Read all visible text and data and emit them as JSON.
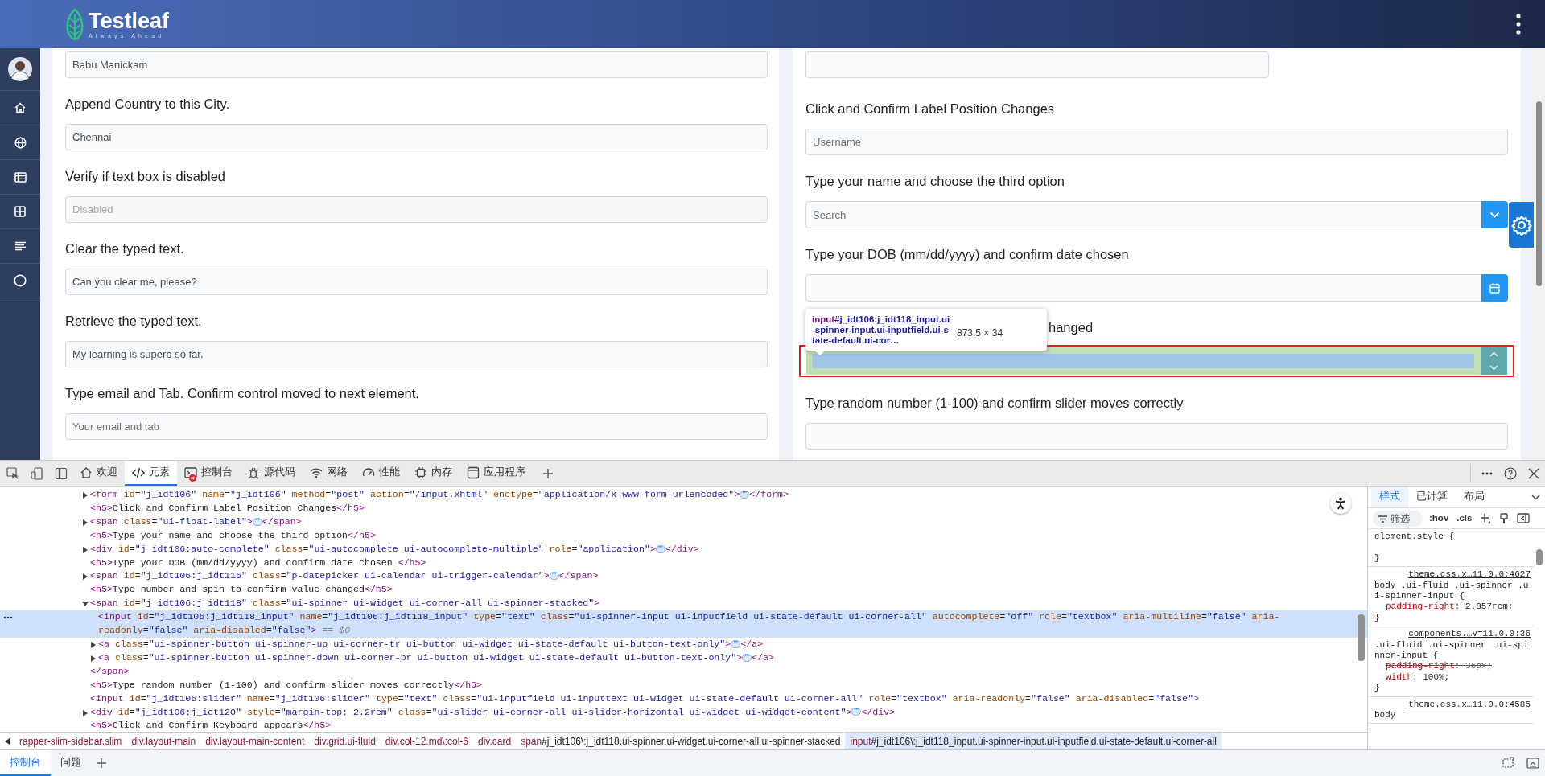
{
  "header": {
    "brand": "Testleaf",
    "tagline": "Always Ahead"
  },
  "left_form": {
    "sections": [
      {
        "value": "Babu Manickam",
        "disabled": false
      },
      {
        "label": "Append Country to this City.",
        "value": "Chennai",
        "disabled": false
      },
      {
        "label": "Verify if text box is disabled",
        "placeholder": "Disabled",
        "disabled": true
      },
      {
        "label": "Clear the typed text.",
        "value": "Can you clear me, please?",
        "disabled": false
      },
      {
        "label": "Retrieve the typed text.",
        "value": "My learning is superb so far.",
        "disabled": false
      },
      {
        "label": "Type email and Tab. Confirm control moved to next element.",
        "placeholder": "Your email and tab",
        "disabled": false
      }
    ]
  },
  "right_form": {
    "sections": [
      {
        "kind": "text"
      },
      {
        "label": "Click and Confirm Label Position Changes",
        "kind": "text",
        "placeholder": "Username"
      },
      {
        "label": "Type your name and choose the third option",
        "kind": "dropdown",
        "placeholder": "Search"
      },
      {
        "label": "Type your DOB (mm/dd/yyyy) and confirm date chosen",
        "kind": "date"
      },
      {
        "label": "hanged",
        "kind": "spinner",
        "highlighted": true
      },
      {
        "label": "Type random number (1-100) and confirm slider moves correctly",
        "kind": "text"
      }
    ]
  },
  "inspect_tooltip": {
    "selector": "input#j_idt106:j_idt118_input.ui-spinner-input.ui-inputfield.ui-state-default.ui-cor…",
    "size": "873.5 × 34"
  },
  "devtools": {
    "tabs": [
      {
        "label": "欢迎",
        "selected": false,
        "has_errors": false
      },
      {
        "label": "元素",
        "selected": true,
        "has_errors": false
      },
      {
        "label": "控制台",
        "selected": false,
        "has_errors": true
      },
      {
        "label": "源代码",
        "selected": false,
        "has_errors": false
      },
      {
        "label": "网络",
        "selected": false,
        "has_errors": false
      },
      {
        "label": "性能",
        "selected": false,
        "has_errors": false
      },
      {
        "label": "内存",
        "selected": false,
        "has_errors": false
      },
      {
        "label": "应用程序",
        "selected": false,
        "has_errors": false
      }
    ],
    "dom_tree": [
      {
        "text": "<form id=\"j_idt106\" name=\"j_idt106\" method=\"post\" action=\"/input.xhtml\" enctype=\"application/x-www-form-urlencoded\">⋯</form>",
        "expanded": false,
        "selected": false
      },
      {
        "text": "<h5>Click and Confirm Label Position Changes</h5>",
        "selected": false
      },
      {
        "text": "<span class=\"ui-float-label\">⋯</span>",
        "expanded": false,
        "selected": false
      },
      {
        "text": "<h5>Type your name and choose the third option</h5>",
        "selected": false
      },
      {
        "text": "<div id=\"j_idt106:auto-complete\" class=\"ui-autocomplete ui-autocomplete-multiple\" role=\"application\">⋯</div>",
        "expanded": false,
        "selected": false
      },
      {
        "text": "<h5>Type your DOB (mm/dd/yyyy) and confirm date chosen </h5>",
        "selected": false
      },
      {
        "text": "<span id=\"j_idt106:j_idt116\" class=\"p-datepicker ui-calendar ui-trigger-calendar\">⋯</span>",
        "expanded": false,
        "selected": false
      },
      {
        "text": "<h5>Type number and spin to confirm value changed</h5>",
        "selected": false
      },
      {
        "text": "<span id=\"j_idt106:j_idt118\" class=\"ui-spinner ui-widget ui-corner-all ui-spinner-stacked\">",
        "expanded": true,
        "selected": false,
        "closing_tag": "</span>",
        "children": [
          {
            "text": "<input id=\"j_idt106:j_idt118_input\" name=\"j_idt106:j_idt118_input\" type=\"text\" class=\"ui-spinner-input ui-inputfield ui-state-default ui-corner-all\" autocomplete=\"off\" role=\"textbox\" aria-multiline=\"false\" aria-readonly=\"false\" aria-disabled=\"false\">",
            "selected": true,
            "console_ref": "== $0"
          },
          {
            "text": "<a class=\"ui-spinner-button ui-spinner-up ui-corner-tr ui-button ui-widget ui-state-default ui-button-text-only\">⋯</a>",
            "expanded": false,
            "selected": false
          },
          {
            "text": "<a class=\"ui-spinner-button ui-spinner-down ui-corner-br ui-button ui-widget ui-state-default ui-button-text-only\">⋯</a>",
            "expanded": false,
            "selected": false
          }
        ]
      },
      {
        "text": "<h5>Type random number (1-100) and confirm slider moves correctly</h5>",
        "selected": false
      },
      {
        "text": "<input id=\"j_idt106:slider\" name=\"j_idt106:slider\" type=\"text\" class=\"ui-inputfield ui-inputtext ui-widget ui-state-default ui-corner-all\" role=\"textbox\" aria-readonly=\"false\" aria-disabled=\"false\">",
        "selected": false
      },
      {
        "text": "<div id=\"j_idt106:j_idt120\" style=\"margin-top: 2.2rem\" class=\"ui-slider ui-corner-all ui-slider-horizontal ui-widget ui-widget-content\">⋯</div>",
        "expanded": false,
        "selected": false
      },
      {
        "text": "<h5>Click and Confirm Keyboard appears</h5>",
        "selected": false
      }
    ],
    "breadcrumb": [
      {
        "label": "rapper-slim-sidebar.slim",
        "selected": false
      },
      {
        "label": "div.layout-main",
        "selected": false
      },
      {
        "label": "div.layout-main-content",
        "selected": false
      },
      {
        "label": "div.grid.ui-fluid",
        "selected": false
      },
      {
        "label": "div.col-12.md\\:col-6",
        "selected": false
      },
      {
        "label": "div.card",
        "selected": false
      },
      {
        "label": "span#j_idt106\\:j_idt118.ui-spinner.ui-widget.ui-corner-all.ui-spinner-stacked",
        "selected": false
      },
      {
        "label": "input#j_idt106\\:j_idt118_input.ui-spinner-input.ui-inputfield.ui-state-default.ui-corner-all",
        "selected": true
      }
    ],
    "styles": {
      "tabs": [
        {
          "label": "样式",
          "selected": true
        },
        {
          "label": "已计算",
          "selected": false
        },
        {
          "label": "布局",
          "selected": false
        }
      ],
      "filter_placeholder": "筛选",
      "toggles": [
        ":hov",
        ".cls"
      ],
      "rules": [
        {
          "selector": "element.style {",
          "close": "}"
        },
        {
          "selector": "body .ui-fluid .ui-spinner .ui-spinner-input {",
          "source": "theme.css.x…11.0.0:4627",
          "declarations": [
            {
              "text": "padding-right: 2.857rem;",
              "overridden": false
            }
          ],
          "close": "}"
        },
        {
          "selector": ".ui-fluid .ui-spinner .ui-spinner-input {",
          "source": "components.…v=11.0.0:36",
          "declarations": [
            {
              "text": "padding-right: 36px;",
              "overridden": true
            },
            {
              "text": "width: 100%;",
              "overridden": false
            }
          ],
          "close": "}"
        },
        {
          "selector": "body",
          "source": "theme.css.x…11.0.0:4585"
        }
      ]
    },
    "drawer_tabs": [
      {
        "label": "控制台",
        "selected": true
      },
      {
        "label": "问题",
        "selected": false
      }
    ]
  }
}
